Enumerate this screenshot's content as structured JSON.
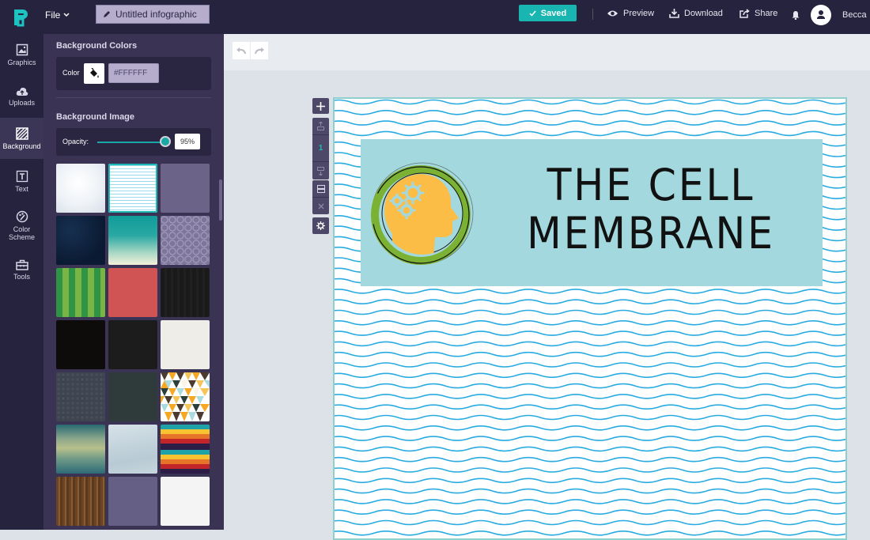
{
  "topbar": {
    "logo": "piktochart-logo",
    "file_menu": "File",
    "document_title": "Untitled infographic",
    "saved_label": "Saved",
    "preview_label": "Preview",
    "download_label": "Download",
    "share_label": "Share",
    "username": "Becca"
  },
  "rail": {
    "items": [
      {
        "label": "Graphics",
        "icon": "image-icon"
      },
      {
        "label": "Uploads",
        "icon": "cloud-upload-icon"
      },
      {
        "label": "Background",
        "icon": "hatch-icon",
        "active": true
      },
      {
        "label": "Text",
        "icon": "text-icon"
      },
      {
        "label": "Color\nScheme",
        "icon": "palette-icon"
      },
      {
        "label": "Tools",
        "icon": "toolbox-icon"
      }
    ]
  },
  "panel": {
    "background_colors_heading": "Background Colors",
    "color_label": "Color",
    "color_value": "#FFFFFF",
    "background_image_heading": "Background Image",
    "opacity_label": "Opacity:",
    "opacity_value": "95%",
    "opacity_fraction": 0.95,
    "thumbnails": [
      {
        "name": "white-gradient",
        "selected": false
      },
      {
        "name": "blue-waves",
        "selected": true
      },
      {
        "name": "purple-linen",
        "selected": false
      },
      {
        "name": "night-sky",
        "selected": false
      },
      {
        "name": "teal-gradient",
        "selected": false
      },
      {
        "name": "purple-swirls",
        "selected": false
      },
      {
        "name": "green-stripes",
        "selected": false
      },
      {
        "name": "red-texture",
        "selected": false
      },
      {
        "name": "dark-wood",
        "selected": false
      },
      {
        "name": "black-solid",
        "selected": false
      },
      {
        "name": "charcoal-texture",
        "selected": false
      },
      {
        "name": "off-white-paper",
        "selected": false
      },
      {
        "name": "slate-dots",
        "selected": false
      },
      {
        "name": "dark-green-slate",
        "selected": false
      },
      {
        "name": "triangle-pattern",
        "selected": false
      },
      {
        "name": "teal-yellow-gradient",
        "selected": false
      },
      {
        "name": "pale-blue-geometric",
        "selected": false
      },
      {
        "name": "chevron-zigzag",
        "selected": false
      },
      {
        "name": "brown-wood",
        "selected": false
      },
      {
        "name": "muted-purple-dots",
        "selected": false
      },
      {
        "name": "white-marble",
        "selected": false
      }
    ]
  },
  "page_tools": {
    "page_number": "1"
  },
  "canvas": {
    "title_line1": "THE CELL",
    "title_line2": "MEMBRANE",
    "colors": {
      "banner": "#a3d9de",
      "wave": "#29abe2",
      "ring_green": "#7cb233",
      "head_orange": "#fbbd46"
    }
  }
}
